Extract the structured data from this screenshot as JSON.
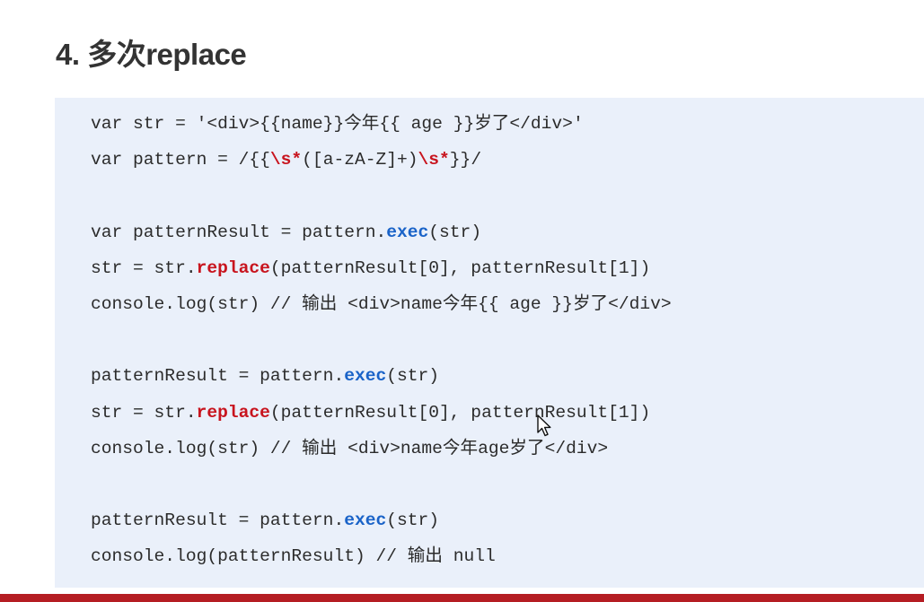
{
  "slide": {
    "title": "4. 多次replace"
  },
  "code": {
    "line1": "var str = '<div>{{name}}今年{{ age }}岁了</div>'",
    "line2": {
      "a": "var pattern = /{{",
      "b": "\\s*",
      "c": "([a-zA-Z]+)",
      "d": "\\s*",
      "e": "}}/"
    },
    "line3": {
      "a": "var patternResult = pattern.",
      "b": "exec",
      "c": "(str)"
    },
    "line4": {
      "a": "str = str.",
      "b": "replace",
      "c": "(patternResult[0], patternResult[1])"
    },
    "line5": "console.log(str) // 输出 <div>name今年{{ age }}岁了</div>",
    "line6": {
      "a": "patternResult = pattern.",
      "b": "exec",
      "c": "(str)"
    },
    "line7": {
      "a": "str = str.",
      "b": "replace",
      "c": "(patternResult[0], patternResult[1])"
    },
    "line8": "console.log(str) // 输出 <div>name今年age岁了</div>",
    "line9": {
      "a": "patternResult = pattern.",
      "b": "exec",
      "c": "(str)"
    },
    "line10": "console.log(patternResult) // 输出 null"
  },
  "colors": {
    "panel_background": "#eaf0fa",
    "keyword_red": "#c8141e",
    "method_blue": "#1a63c8",
    "bottom_bar": "#b51d23"
  },
  "icons": {
    "cursor": "mouse-pointer-icon"
  }
}
